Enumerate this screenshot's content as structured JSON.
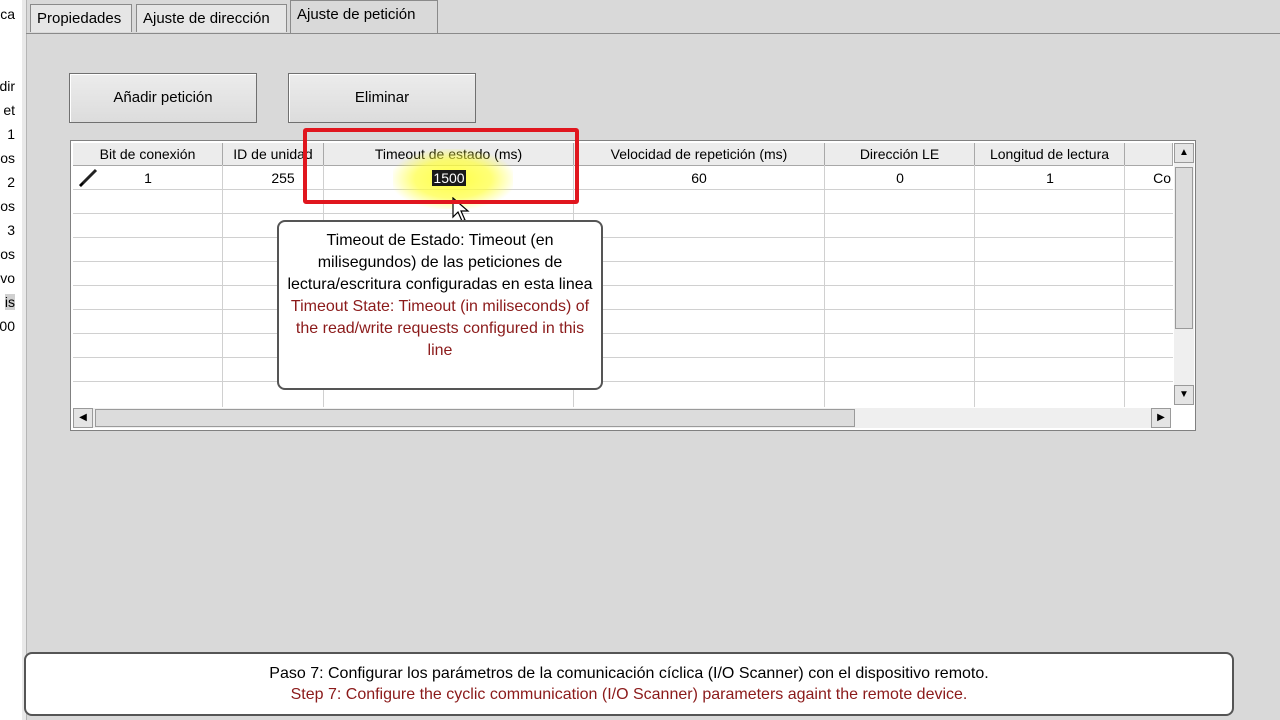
{
  "left_tree": {
    "fragments": [
      "ca",
      "dir",
      "et",
      "1",
      "os",
      "2",
      "os",
      "3",
      "os",
      "vo",
      "is",
      "00"
    ]
  },
  "tabs": [
    {
      "label": "Propiedades"
    },
    {
      "label": "Ajuste de dirección"
    },
    {
      "label": "Ajuste de petición"
    }
  ],
  "toolbar": {
    "add_label": "Añadir petición",
    "delete_label": "Eliminar"
  },
  "grid": {
    "columns": [
      "Bit de conexión",
      "ID de unidad",
      "Timeout de estado (ms)",
      "Velocidad de repetición (ms)",
      "Dirección LE",
      "Longitud de lectura",
      ""
    ],
    "rows": [
      {
        "cells": [
          "1",
          "255",
          "1500",
          "60",
          "0",
          "1",
          "Co"
        ]
      }
    ]
  },
  "callout": {
    "es": "Timeout de Estado: Timeout (en milisegundos) de las peticiones de lectura/escritura configuradas en esta linea",
    "en": "Timeout State: Timeout (in miliseconds) of the read/write requests configured in this line"
  },
  "caption": {
    "es": "Paso 7: Configurar los parámetros de la comunicación cíclica (I/O Scanner) con el dispositivo remoto.",
    "en": "Step 7: Configure the cyclic communication (I/O Scanner) parameters againt the remote device."
  },
  "colors": {
    "annotation_red": "#e0161e",
    "english_text": "#8b1a1a",
    "highlight_yellow": "#ffff3c"
  }
}
